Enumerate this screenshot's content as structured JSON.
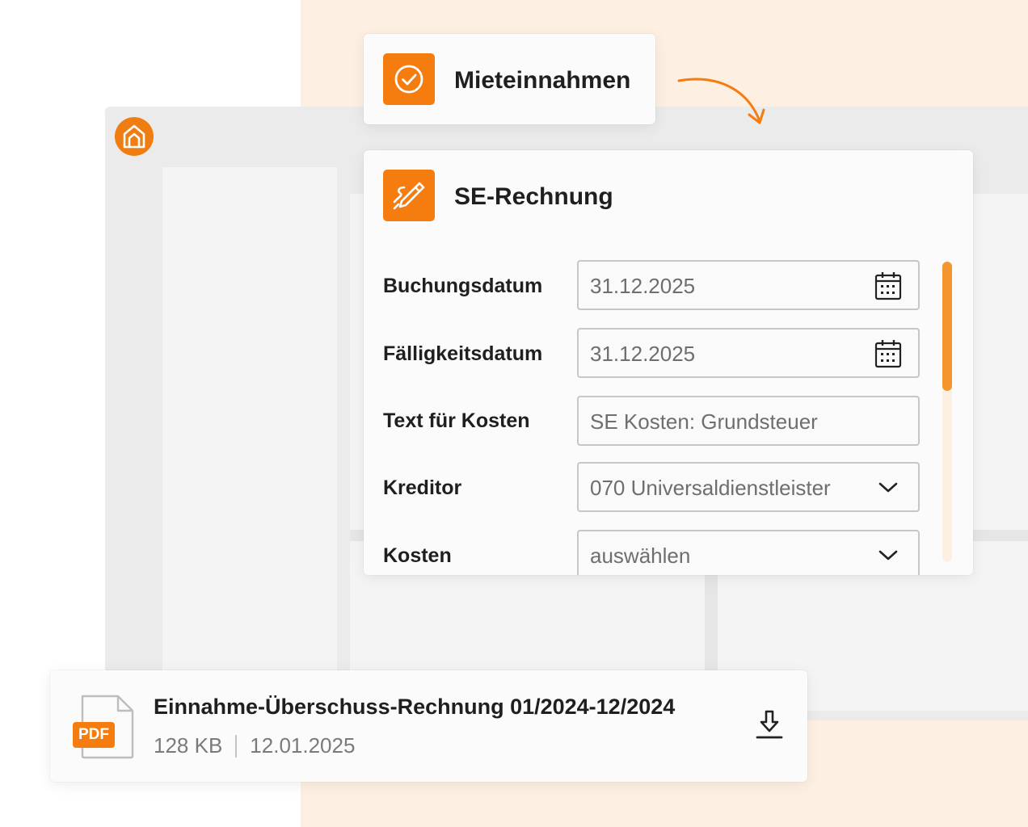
{
  "colors": {
    "accent": "#f57c0e",
    "background_peach": "#fdf0e3",
    "window_gray": "#ebebeb"
  },
  "income_card": {
    "title": "Mieteinnahmen",
    "icon": "check-circle-icon"
  },
  "invoice_form": {
    "title": "SE-Rechnung",
    "icon": "signature-pen-icon",
    "fields": [
      {
        "label": "Buchungsdatum",
        "value": "31.12.2025",
        "type": "date",
        "icon": "calendar-icon"
      },
      {
        "label": "Fälligkeitsdatum",
        "value": "31.12.2025",
        "type": "date",
        "icon": "calendar-icon"
      },
      {
        "label": "Text für Kosten",
        "value": "SE Kosten: Grundsteuer",
        "type": "text"
      },
      {
        "label": "Kreditor",
        "value": "070 Universaldienstleister",
        "type": "select",
        "icon": "chevron-down-icon"
      },
      {
        "label": "Kosten",
        "value": "auswählen",
        "type": "select",
        "icon": "chevron-down-icon"
      }
    ]
  },
  "file_download": {
    "badge": "PDF",
    "name": "Einnahme-Überschuss-Rechnung 01/2024-12/2024",
    "size": "128 KB",
    "date": "12.01.2025",
    "icon": "download-icon"
  }
}
